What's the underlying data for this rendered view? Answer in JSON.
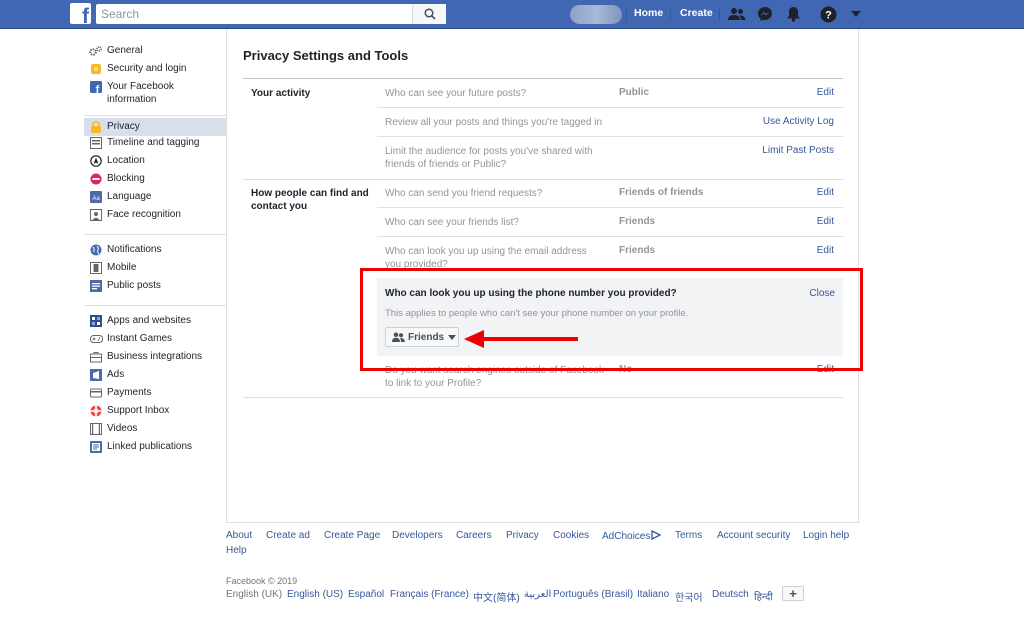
{
  "topbar": {
    "logo": "f",
    "search_placeholder": "Search",
    "home": "Home",
    "create": "Create",
    "icons": [
      "friends-icon",
      "messenger-icon",
      "notifications-icon",
      "help-icon",
      "dropdown-icon"
    ]
  },
  "sidebar": {
    "items": [
      {
        "label": "General",
        "icon": "gear-icon"
      },
      {
        "label": "Security and login",
        "icon": "shield-icon"
      },
      {
        "label": "Your Facebook information",
        "icon": "facebook-icon"
      },
      {
        "label": "Privacy",
        "icon": "lock-icon"
      },
      {
        "label": "Timeline and tagging",
        "icon": "timeline-icon"
      },
      {
        "label": "Location",
        "icon": "location-icon"
      },
      {
        "label": "Blocking",
        "icon": "block-icon"
      },
      {
        "label": "Language",
        "icon": "language-icon"
      },
      {
        "label": "Face recognition",
        "icon": "face-icon"
      },
      {
        "label": "Notifications",
        "icon": "globe-icon"
      },
      {
        "label": "Mobile",
        "icon": "mobile-icon"
      },
      {
        "label": "Public posts",
        "icon": "public-posts-icon"
      },
      {
        "label": "Apps and websites",
        "icon": "apps-icon"
      },
      {
        "label": "Instant Games",
        "icon": "games-icon"
      },
      {
        "label": "Business integrations",
        "icon": "business-icon"
      },
      {
        "label": "Ads",
        "icon": "ads-icon"
      },
      {
        "label": "Payments",
        "icon": "payments-icon"
      },
      {
        "label": "Support Inbox",
        "icon": "support-icon"
      },
      {
        "label": "Videos",
        "icon": "videos-icon"
      },
      {
        "label": "Linked publications",
        "icon": "publications-icon"
      }
    ]
  },
  "main": {
    "title": "Privacy Settings and Tools",
    "your_activity": {
      "label": "Your activity",
      "rows": [
        {
          "question": "Who can see your future posts?",
          "value": "Public",
          "action": "Edit"
        },
        {
          "question": "Review all your posts and things you're tagged in",
          "value": "",
          "action": "Use Activity Log"
        },
        {
          "question": "Limit the audience for posts you've shared with friends of friends or Public?",
          "value": "",
          "action": "Limit Past Posts"
        }
      ]
    },
    "find_contact": {
      "label": "How people can find and contact you",
      "rows": [
        {
          "question": "Who can send you friend requests?",
          "value": "Friends of friends",
          "action": "Edit"
        },
        {
          "question": "Who can see your friends list?",
          "value": "Friends",
          "action": "Edit"
        },
        {
          "question": "Who can look you up using the email address you provided?",
          "value": "Friends",
          "action": "Edit"
        }
      ],
      "expanded": {
        "title": "Who can look you up using the phone number you provided?",
        "close": "Close",
        "note": "This applies to people who can't see your phone number on your profile.",
        "selected": "Friends"
      },
      "last_row": {
        "question": "Do you want search engines outside of Facebook to link to your Profile?",
        "value": "No",
        "action": "Edit"
      }
    }
  },
  "footer": {
    "links": [
      "About",
      "Create ad",
      "Create Page",
      "Developers",
      "Careers",
      "Privacy",
      "Cookies",
      "AdChoices",
      "Terms",
      "Account security",
      "Login help",
      "Help"
    ],
    "copyright": "Facebook © 2019",
    "languages": [
      "English (UK)",
      "English (US)",
      "Español",
      "Français (France)",
      "中文(简体)",
      "العربية",
      "Português (Brasil)",
      "Italiano",
      "한국어",
      "Deutsch",
      "हिन्दी"
    ],
    "plus": "+"
  },
  "colors": {
    "brand": "#4267b2",
    "link": "#365899",
    "annotation": "#e00000"
  }
}
